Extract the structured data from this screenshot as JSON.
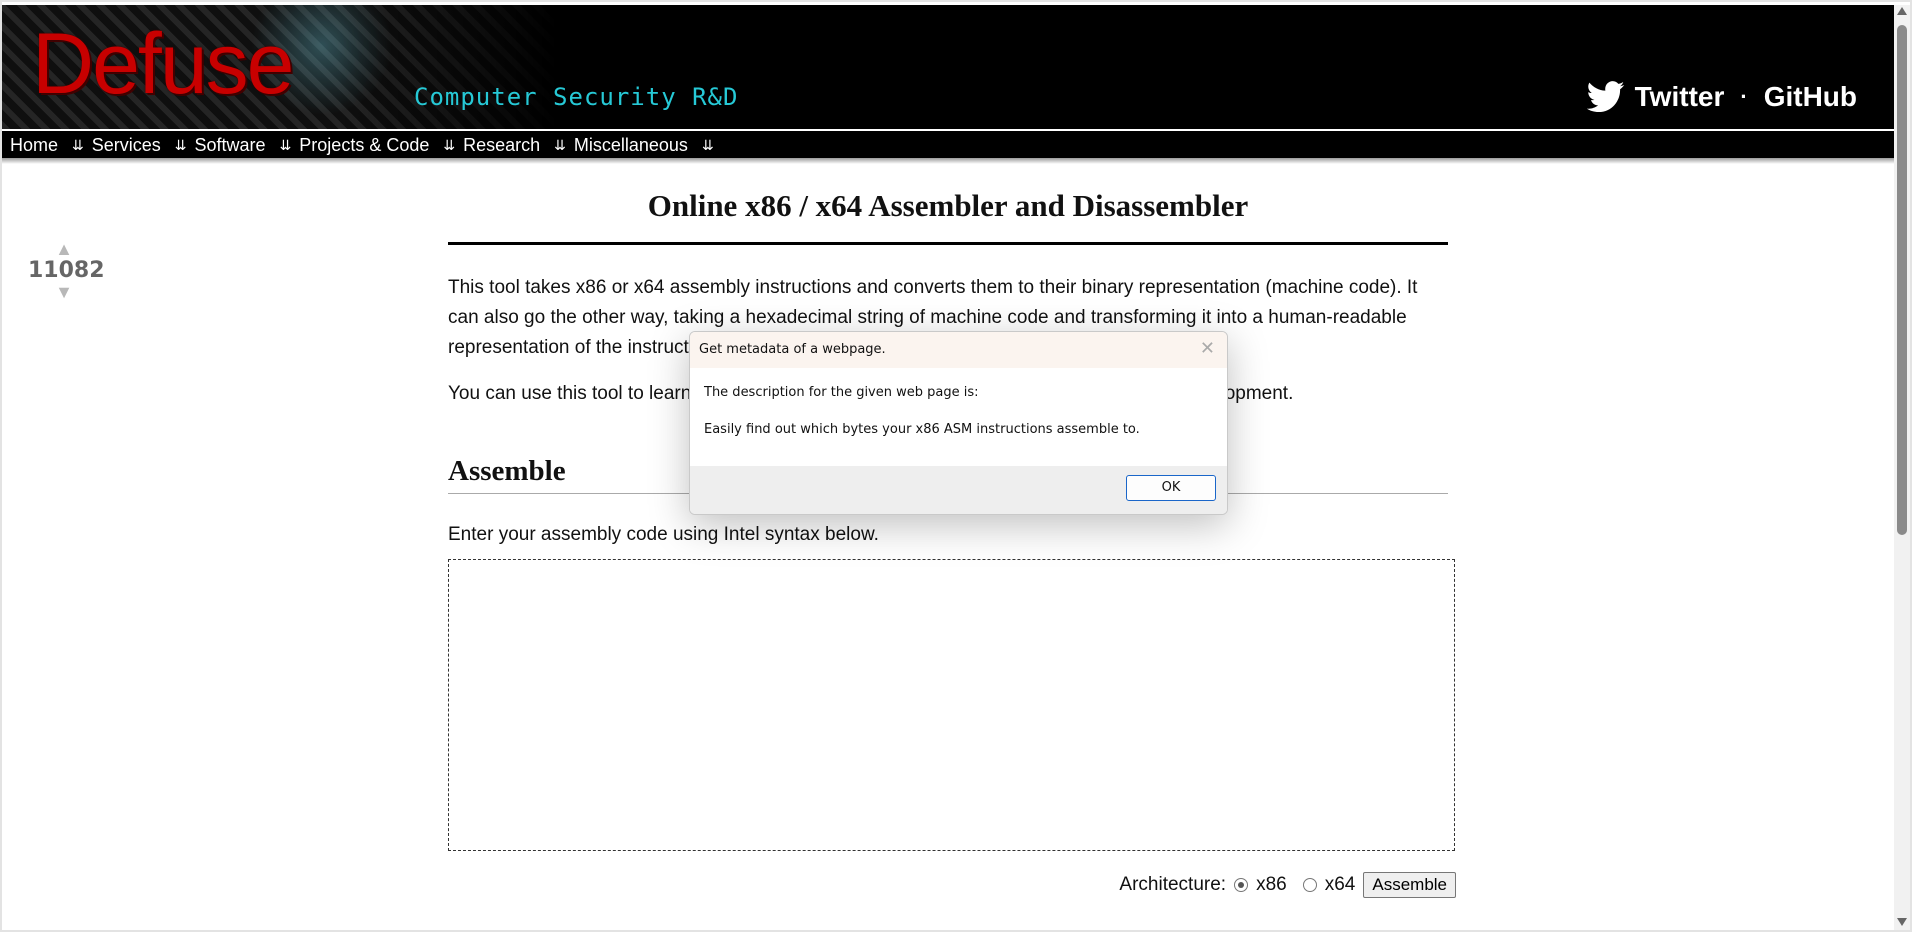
{
  "header": {
    "logo": "Defuse",
    "tagline": "Computer Security R&D",
    "social": {
      "twitter_label": "Twitter",
      "separator": "·",
      "github_label": "GitHub"
    }
  },
  "nav": {
    "items": [
      {
        "label": "Home"
      },
      {
        "label": "Services"
      },
      {
        "label": "Software"
      },
      {
        "label": "Projects & Code"
      },
      {
        "label": "Research"
      },
      {
        "label": "Miscellaneous"
      }
    ],
    "chevron": "»"
  },
  "vote": {
    "count": "11082"
  },
  "main": {
    "title": "Online x86 / x64 Assembler and Disassembler",
    "intro_p1": "This tool takes x86 or x64 assembly instructions and converts them to their binary representation (machine code). It can also go the other way, taking a hexadecimal string of machine code and transforming it into a human-readable representation of the instructions. It uses GCC and objdump behind the scenes.",
    "intro_p2": "You can use this tool to learn about the x86 instruction encoding or help with shellcode development.",
    "assemble_heading": "Assemble",
    "assemble_instructions": "Enter your assembly code using Intel syntax below.",
    "architecture_label": "Architecture:",
    "arch_options": [
      "x86",
      "x64"
    ],
    "arch_selected": "x86",
    "assemble_button": "Assemble"
  },
  "dialog": {
    "title": "Get metadata of a webpage.",
    "line1": "The description for the given web page is:",
    "line2": "Easily find out which bytes your x86 ASM instructions assemble to.",
    "ok_label": "OK"
  }
}
